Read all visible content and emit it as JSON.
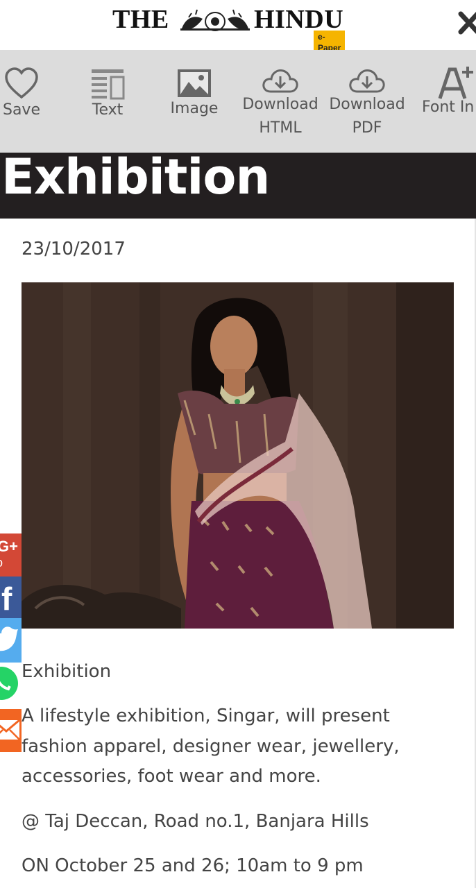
{
  "masthead": {
    "title_left": "THE",
    "title_right": "HINDU",
    "edition_badge": "e-Paper",
    "emblem_icon": "hindu-emblem-icon",
    "close_icon": "close-icon"
  },
  "toolbar": {
    "items": [
      {
        "label": "Save",
        "icon": "heart-icon"
      },
      {
        "label": "Text",
        "icon": "text-layout-icon"
      },
      {
        "label": "Image",
        "icon": "image-icon"
      },
      {
        "label_line1": "Download",
        "label_line2": "HTML",
        "icon": "cloud-download-icon"
      },
      {
        "label_line1": "Download",
        "label_line2": "PDF",
        "icon": "cloud-download-icon"
      },
      {
        "label": "Font In",
        "icon": "font-increase-icon"
      }
    ]
  },
  "article": {
    "headline": "Exhibition",
    "date": "23/10/2017",
    "photo": "fashion-model-lehenga-photo",
    "subheading": "Exhibition",
    "body": "A lifestyle exhibition, Singar, will present fashion apparel, designer wear, jewellery, accessories, foot wear and more.",
    "venue": "@ Taj Deccan, Road no.1, Banjara Hills",
    "dates": "ON October 25 and 26; 10am to 9 pm"
  },
  "social_share": [
    {
      "network": "google-plus",
      "glyph": "G+",
      "color": "#d34836"
    },
    {
      "network": "facebook",
      "glyph": "f",
      "color": "#3b5998"
    },
    {
      "network": "twitter",
      "color": "#55acee"
    },
    {
      "network": "whatsapp",
      "color": "#25d366"
    },
    {
      "network": "email",
      "color": "#f26522"
    }
  ],
  "colors": {
    "toolbar_bg": "#dcdcdc",
    "title_band_bg": "#231f20",
    "epaper_badge": "#f5b400"
  }
}
